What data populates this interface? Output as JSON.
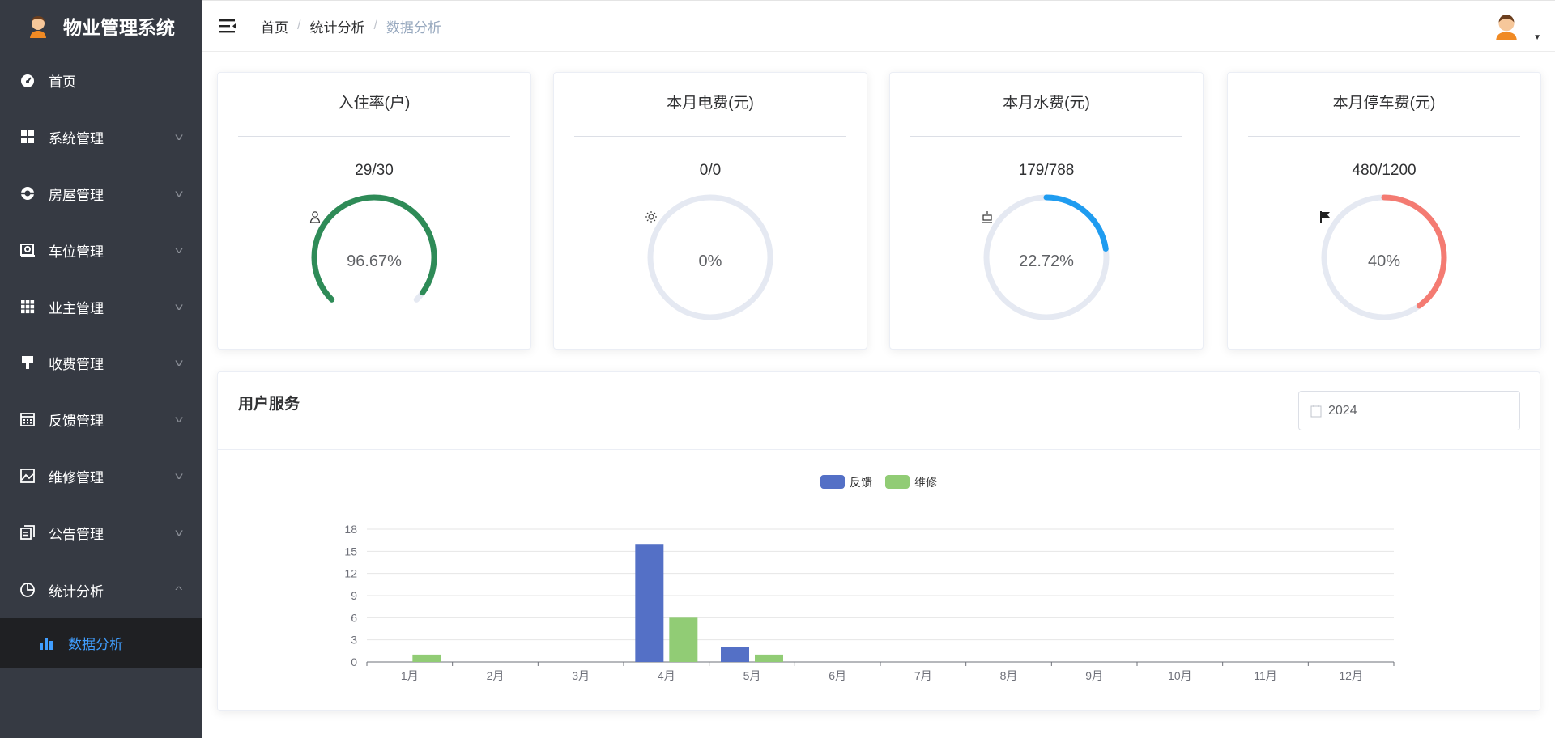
{
  "app": {
    "title": "物业管理系统"
  },
  "sidebar": {
    "items": [
      {
        "label": "首页",
        "icon": "dashboard-icon"
      },
      {
        "label": "系统管理",
        "icon": "grid-icon"
      },
      {
        "label": "房屋管理",
        "icon": "lifebuoy-icon"
      },
      {
        "label": "车位管理",
        "icon": "parking-icon"
      },
      {
        "label": "业主管理",
        "icon": "apps-icon"
      },
      {
        "label": "收费管理",
        "icon": "brush-icon"
      },
      {
        "label": "反馈管理",
        "icon": "calendar-icon"
      },
      {
        "label": "维修管理",
        "icon": "picture-icon"
      },
      {
        "label": "公告管理",
        "icon": "document-icon"
      },
      {
        "label": "统计分析",
        "icon": "pie-chart-icon"
      }
    ],
    "active_sub": {
      "label": "数据分析",
      "icon": "bar-chart-icon"
    }
  },
  "header": {
    "breadcrumb": [
      "首页",
      "统计分析",
      "数据分析"
    ],
    "separator": "/"
  },
  "cards": [
    {
      "title": "入住率(户)",
      "icon": "user-icon",
      "value": "29/30",
      "percent_label": "96.67%",
      "percent": 96.67,
      "type": "dashboard",
      "color": "#2e8b57"
    },
    {
      "title": "本月电费(元)",
      "icon": "sun-icon",
      "value": "0/0",
      "percent_label": "0%",
      "percent": 0,
      "type": "circle",
      "color": "#1f9cf0"
    },
    {
      "title": "本月水费(元)",
      "icon": "cup-icon",
      "value": "179/788",
      "percent_label": "22.72%",
      "percent": 22.72,
      "type": "circle",
      "color": "#1f9cf0"
    },
    {
      "title": "本月停车费(元)",
      "icon": "flag-icon",
      "value": "480/1200",
      "percent_label": "40%",
      "percent": 40,
      "type": "circle",
      "color": "#f47b72"
    }
  ],
  "service": {
    "title": "用户服务",
    "year": "2024"
  },
  "chart_data": {
    "type": "bar",
    "categories": [
      "1月",
      "2月",
      "3月",
      "4月",
      "5月",
      "6月",
      "7月",
      "8月",
      "9月",
      "10月",
      "11月",
      "12月"
    ],
    "series": [
      {
        "name": "反馈",
        "color": "#5470c6",
        "values": [
          0,
          0,
          0,
          16,
          2,
          0,
          0,
          0,
          0,
          0,
          0,
          0
        ]
      },
      {
        "name": "维修",
        "color": "#91cc75",
        "values": [
          1,
          0,
          0,
          6,
          1,
          0,
          0,
          0,
          0,
          0,
          0,
          0
        ]
      }
    ],
    "yticks": [
      0,
      3,
      6,
      9,
      12,
      15,
      18
    ],
    "ylim": [
      0,
      18
    ],
    "legend": "top-center",
    "grid": true
  }
}
